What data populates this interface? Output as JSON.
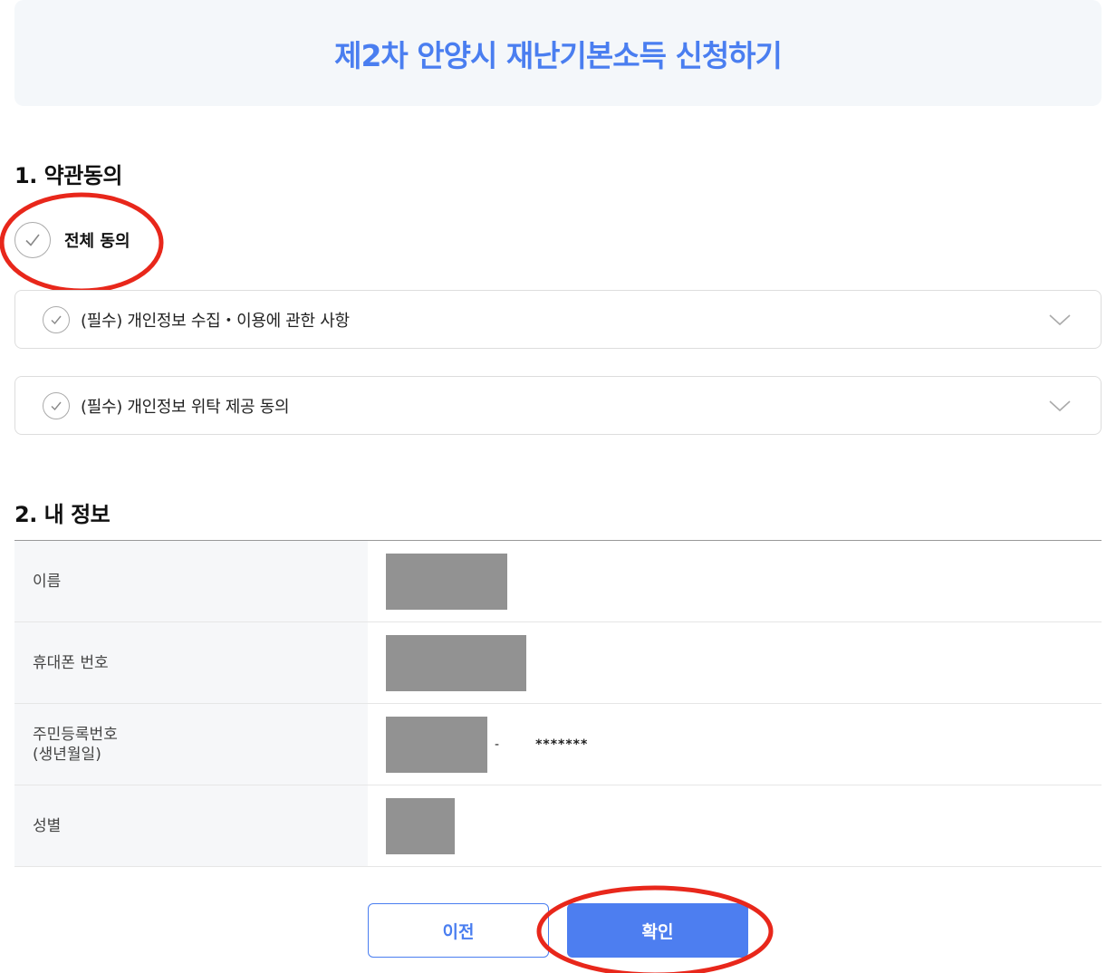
{
  "header": {
    "title": "제2차 안양시 재난기본소득 신청하기"
  },
  "terms": {
    "section_title": "1. 약관동의",
    "agree_all_label": "전체 동의",
    "items": [
      {
        "label": "(필수) 개인정보 수집・이용에 관한 사항"
      },
      {
        "label": "(필수) 개인정보 위탁 제공 동의"
      }
    ]
  },
  "my_info": {
    "section_title": "2. 내 정보",
    "rows": [
      {
        "label": "이름"
      },
      {
        "label": "휴대폰 번호"
      },
      {
        "label_line1": "주민등록번호",
        "label_line2": "(생년월일)",
        "dash": "-",
        "masked": "*******"
      },
      {
        "label": "성별"
      }
    ]
  },
  "buttons": {
    "prev_label": "이전",
    "confirm_label": "확인"
  },
  "colors": {
    "accent": "#4a7ef0",
    "annotation": "#e8271b",
    "redaction": "#929292"
  },
  "icons": {
    "check": "check-icon",
    "chevron": "chevron-down-icon"
  }
}
